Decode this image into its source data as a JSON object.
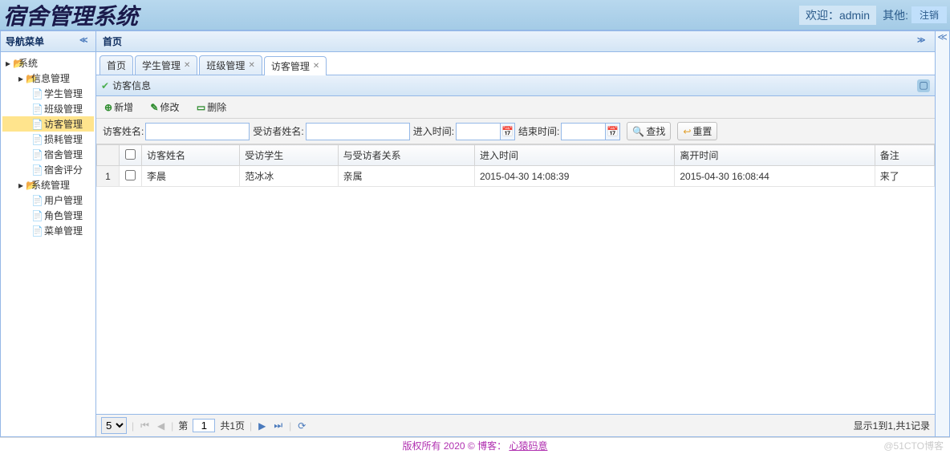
{
  "header": {
    "logo": "宿舍管理系统",
    "welcome": "欢迎：admin",
    "other": "其他:",
    "logout": "注销"
  },
  "west": {
    "title": "导航菜单",
    "tree": [
      {
        "label": "系统",
        "icon": "folder-open",
        "depth": 0
      },
      {
        "label": "信息管理",
        "icon": "folder-open",
        "depth": 1
      },
      {
        "label": "学生管理",
        "icon": "page",
        "depth": 2
      },
      {
        "label": "班级管理",
        "icon": "page",
        "depth": 2
      },
      {
        "label": "访客管理",
        "icon": "page",
        "depth": 2,
        "selected": true
      },
      {
        "label": "损耗管理",
        "icon": "page",
        "depth": 2
      },
      {
        "label": "宿舍管理",
        "icon": "page",
        "depth": 2
      },
      {
        "label": "宿舍评分",
        "icon": "page",
        "depth": 2
      },
      {
        "label": "系统管理",
        "icon": "folder-open",
        "depth": 1
      },
      {
        "label": "用户管理",
        "icon": "page",
        "depth": 2
      },
      {
        "label": "角色管理",
        "icon": "page",
        "depth": 2
      },
      {
        "label": "菜单管理",
        "icon": "page",
        "depth": 2
      }
    ]
  },
  "center": {
    "page_title": "首页",
    "tabs": [
      {
        "label": "首页",
        "closable": false
      },
      {
        "label": "学生管理",
        "closable": true
      },
      {
        "label": "班级管理",
        "closable": true
      },
      {
        "label": "访客管理",
        "closable": true,
        "active": true
      }
    ],
    "panel_title": "访客信息",
    "toolbar": {
      "add": "新增",
      "edit": "修改",
      "del": "删除"
    },
    "search": {
      "visitor_name_label": "访客姓名:",
      "visited_name_label": "受访者姓名:",
      "in_time_label": "进入时间:",
      "end_time_label": "结束时间:",
      "search_btn": "查找",
      "reset_btn": "重置"
    },
    "grid": {
      "headers": [
        "访客姓名",
        "受访学生",
        "与受访者关系",
        "进入时间",
        "离开时间",
        "备注"
      ],
      "rows": [
        {
          "num": "1",
          "cells": [
            "李晨",
            "范冰冰",
            "亲属",
            "2015-04-30 14:08:39",
            "2015-04-30 16:08:44",
            "来了"
          ]
        }
      ]
    },
    "pager": {
      "page_size": "5",
      "page_label_prefix": "第",
      "current_page": "1",
      "total_pages_label": "共1页",
      "display_msg": "显示1到1,共1记录"
    }
  },
  "footer": {
    "copyright_prefix": "版权所有 2020 © 博客：",
    "link": "心猿码意",
    "watermark": "@51CTO博客"
  }
}
